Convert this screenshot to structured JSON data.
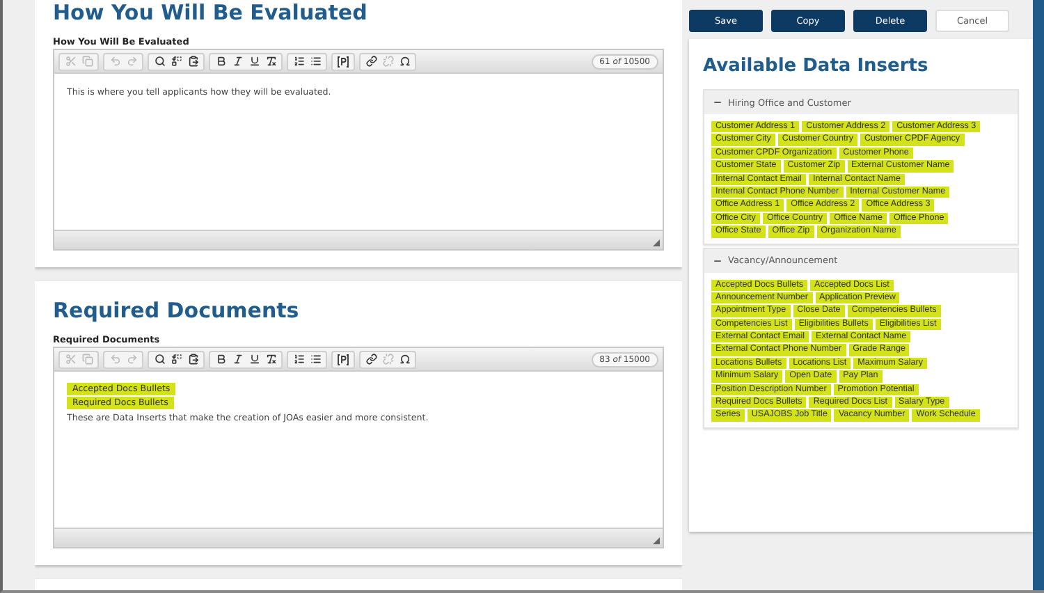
{
  "sections": [
    {
      "title": "How You Will Be Evaluated",
      "editor": {
        "label": "How You Will Be Evaluated",
        "counter": "61 *of* 10500",
        "toolbar": [
          [
            {
              "kind": "cut",
              "disabled": true
            },
            {
              "kind": "copy",
              "disabled": true
            }
          ],
          [
            {
              "kind": "undo",
              "disabled": true
            },
            {
              "kind": "redo",
              "disabled": true
            }
          ],
          [
            {
              "kind": "find",
              "disabled": false
            },
            {
              "kind": "replace",
              "disabled": false
            },
            {
              "kind": "paste",
              "disabled": false
            }
          ],
          [
            {
              "kind": "bold",
              "disabled": false
            },
            {
              "kind": "italic",
              "disabled": false
            },
            {
              "kind": "underline",
              "disabled": false
            },
            {
              "kind": "clear",
              "disabled": false
            }
          ],
          [
            {
              "kind": "ol",
              "disabled": false
            },
            {
              "kind": "ul",
              "disabled": false
            }
          ],
          [
            {
              "kind": "placeholder",
              "disabled": false
            }
          ],
          [
            {
              "kind": "link",
              "disabled": false
            },
            {
              "kind": "unlink",
              "disabled": true
            },
            {
              "kind": "special",
              "disabled": false
            }
          ]
        ],
        "content": [
          {
            "kind": "text",
            "text": "This is where you tell applicants how they will be evaluated."
          }
        ]
      }
    },
    {
      "title": "Required Documents",
      "editor": {
        "label": "Required Documents",
        "counter": "83 *of* 15000",
        "toolbar": [
          [
            {
              "kind": "cut",
              "disabled": true
            },
            {
              "kind": "copy",
              "disabled": true
            }
          ],
          [
            {
              "kind": "undo",
              "disabled": true
            },
            {
              "kind": "redo",
              "disabled": true
            }
          ],
          [
            {
              "kind": "find",
              "disabled": false
            },
            {
              "kind": "replace",
              "disabled": false
            },
            {
              "kind": "paste",
              "disabled": false
            }
          ],
          [
            {
              "kind": "bold",
              "disabled": false
            },
            {
              "kind": "italic",
              "disabled": false
            },
            {
              "kind": "underline",
              "disabled": false
            },
            {
              "kind": "clear",
              "disabled": false
            }
          ],
          [
            {
              "kind": "ol",
              "disabled": false
            },
            {
              "kind": "ul",
              "disabled": false
            }
          ],
          [
            {
              "kind": "placeholder",
              "disabled": false
            }
          ],
          [
            {
              "kind": "link",
              "disabled": false
            },
            {
              "kind": "unlink",
              "disabled": true
            },
            {
              "kind": "special",
              "disabled": false
            }
          ]
        ],
        "content": [
          {
            "kind": "insert",
            "text": "Accepted Docs Bullets"
          },
          {
            "kind": "insert",
            "text": "Required Docs Bullets"
          },
          {
            "kind": "text",
            "text": "These are Data Inserts that make the creation of JOAs easier and more consistent."
          }
        ]
      }
    }
  ],
  "actions": [
    {
      "label": "Save",
      "kind": "primary"
    },
    {
      "label": "Copy",
      "kind": "primary"
    },
    {
      "label": "Delete",
      "kind": "primary"
    },
    {
      "label": "Cancel",
      "kind": "secondary"
    }
  ],
  "inserts_panel": {
    "title": "Available Data Inserts",
    "groups": [
      {
        "title": "Hiring Office and Customer",
        "expanded": true,
        "items": [
          "Customer Address 1",
          "Customer Address 2",
          "Customer Address 3",
          "Customer City",
          "Customer Country",
          "Customer CPDF Agency",
          "Customer CPDF Organization",
          "Customer Phone",
          "Customer State",
          "Customer Zip",
          "External Customer Name",
          "Internal Contact Email",
          "Internal Contact Name",
          "Internal Contact Phone Number",
          "Internal Customer Name",
          "Office Address 1",
          "Office Address 2",
          "Office Address 3",
          "Office City",
          "Office Country",
          "Office Name",
          "Office Phone",
          "Office State",
          "Office Zip",
          "Organization Name"
        ]
      },
      {
        "title": "Vacancy/Announcement",
        "expanded": true,
        "items": [
          "Accepted Docs Bullets",
          "Accepted Docs List",
          "Announcement Number",
          "Application Preview",
          "Appointment Type",
          "Close Date",
          "Competencies Bullets",
          "Competencies List",
          "Eligibilities Bullets",
          "Eligibilities List",
          "External Contact Email",
          "External Contact Name",
          "External Contact Phone Number",
          "Grade Range",
          "Locations Bullets",
          "Locations List",
          "Maximum Salary",
          "Minimum Salary",
          "Open Date",
          "Pay Plan",
          "Position Description Number",
          "Promotion Potential",
          "Required Docs Bullets",
          "Required Docs List",
          "Salary Type",
          "Series",
          "USAJOBS Job Title",
          "Vacancy Number",
          "Work Schedule"
        ]
      }
    ]
  }
}
